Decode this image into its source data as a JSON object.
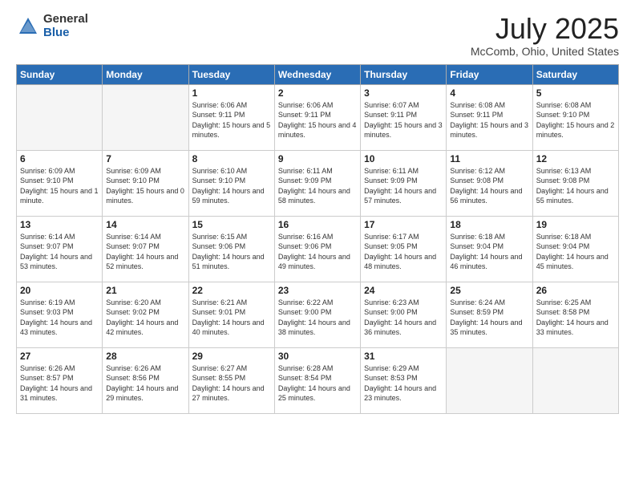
{
  "header": {
    "logo_general": "General",
    "logo_blue": "Blue",
    "title": "July 2025",
    "location": "McComb, Ohio, United States"
  },
  "days_of_week": [
    "Sunday",
    "Monday",
    "Tuesday",
    "Wednesday",
    "Thursday",
    "Friday",
    "Saturday"
  ],
  "weeks": [
    [
      {
        "num": "",
        "empty": true
      },
      {
        "num": "",
        "empty": true
      },
      {
        "num": "1",
        "sunrise": "Sunrise: 6:06 AM",
        "sunset": "Sunset: 9:11 PM",
        "daylight": "Daylight: 15 hours and 5 minutes."
      },
      {
        "num": "2",
        "sunrise": "Sunrise: 6:06 AM",
        "sunset": "Sunset: 9:11 PM",
        "daylight": "Daylight: 15 hours and 4 minutes."
      },
      {
        "num": "3",
        "sunrise": "Sunrise: 6:07 AM",
        "sunset": "Sunset: 9:11 PM",
        "daylight": "Daylight: 15 hours and 3 minutes."
      },
      {
        "num": "4",
        "sunrise": "Sunrise: 6:08 AM",
        "sunset": "Sunset: 9:11 PM",
        "daylight": "Daylight: 15 hours and 3 minutes."
      },
      {
        "num": "5",
        "sunrise": "Sunrise: 6:08 AM",
        "sunset": "Sunset: 9:10 PM",
        "daylight": "Daylight: 15 hours and 2 minutes."
      }
    ],
    [
      {
        "num": "6",
        "sunrise": "Sunrise: 6:09 AM",
        "sunset": "Sunset: 9:10 PM",
        "daylight": "Daylight: 15 hours and 1 minute."
      },
      {
        "num": "7",
        "sunrise": "Sunrise: 6:09 AM",
        "sunset": "Sunset: 9:10 PM",
        "daylight": "Daylight: 15 hours and 0 minutes."
      },
      {
        "num": "8",
        "sunrise": "Sunrise: 6:10 AM",
        "sunset": "Sunset: 9:10 PM",
        "daylight": "Daylight: 14 hours and 59 minutes."
      },
      {
        "num": "9",
        "sunrise": "Sunrise: 6:11 AM",
        "sunset": "Sunset: 9:09 PM",
        "daylight": "Daylight: 14 hours and 58 minutes."
      },
      {
        "num": "10",
        "sunrise": "Sunrise: 6:11 AM",
        "sunset": "Sunset: 9:09 PM",
        "daylight": "Daylight: 14 hours and 57 minutes."
      },
      {
        "num": "11",
        "sunrise": "Sunrise: 6:12 AM",
        "sunset": "Sunset: 9:08 PM",
        "daylight": "Daylight: 14 hours and 56 minutes."
      },
      {
        "num": "12",
        "sunrise": "Sunrise: 6:13 AM",
        "sunset": "Sunset: 9:08 PM",
        "daylight": "Daylight: 14 hours and 55 minutes."
      }
    ],
    [
      {
        "num": "13",
        "sunrise": "Sunrise: 6:14 AM",
        "sunset": "Sunset: 9:07 PM",
        "daylight": "Daylight: 14 hours and 53 minutes."
      },
      {
        "num": "14",
        "sunrise": "Sunrise: 6:14 AM",
        "sunset": "Sunset: 9:07 PM",
        "daylight": "Daylight: 14 hours and 52 minutes."
      },
      {
        "num": "15",
        "sunrise": "Sunrise: 6:15 AM",
        "sunset": "Sunset: 9:06 PM",
        "daylight": "Daylight: 14 hours and 51 minutes."
      },
      {
        "num": "16",
        "sunrise": "Sunrise: 6:16 AM",
        "sunset": "Sunset: 9:06 PM",
        "daylight": "Daylight: 14 hours and 49 minutes."
      },
      {
        "num": "17",
        "sunrise": "Sunrise: 6:17 AM",
        "sunset": "Sunset: 9:05 PM",
        "daylight": "Daylight: 14 hours and 48 minutes."
      },
      {
        "num": "18",
        "sunrise": "Sunrise: 6:18 AM",
        "sunset": "Sunset: 9:04 PM",
        "daylight": "Daylight: 14 hours and 46 minutes."
      },
      {
        "num": "19",
        "sunrise": "Sunrise: 6:18 AM",
        "sunset": "Sunset: 9:04 PM",
        "daylight": "Daylight: 14 hours and 45 minutes."
      }
    ],
    [
      {
        "num": "20",
        "sunrise": "Sunrise: 6:19 AM",
        "sunset": "Sunset: 9:03 PM",
        "daylight": "Daylight: 14 hours and 43 minutes."
      },
      {
        "num": "21",
        "sunrise": "Sunrise: 6:20 AM",
        "sunset": "Sunset: 9:02 PM",
        "daylight": "Daylight: 14 hours and 42 minutes."
      },
      {
        "num": "22",
        "sunrise": "Sunrise: 6:21 AM",
        "sunset": "Sunset: 9:01 PM",
        "daylight": "Daylight: 14 hours and 40 minutes."
      },
      {
        "num": "23",
        "sunrise": "Sunrise: 6:22 AM",
        "sunset": "Sunset: 9:00 PM",
        "daylight": "Daylight: 14 hours and 38 minutes."
      },
      {
        "num": "24",
        "sunrise": "Sunrise: 6:23 AM",
        "sunset": "Sunset: 9:00 PM",
        "daylight": "Daylight: 14 hours and 36 minutes."
      },
      {
        "num": "25",
        "sunrise": "Sunrise: 6:24 AM",
        "sunset": "Sunset: 8:59 PM",
        "daylight": "Daylight: 14 hours and 35 minutes."
      },
      {
        "num": "26",
        "sunrise": "Sunrise: 6:25 AM",
        "sunset": "Sunset: 8:58 PM",
        "daylight": "Daylight: 14 hours and 33 minutes."
      }
    ],
    [
      {
        "num": "27",
        "sunrise": "Sunrise: 6:26 AM",
        "sunset": "Sunset: 8:57 PM",
        "daylight": "Daylight: 14 hours and 31 minutes."
      },
      {
        "num": "28",
        "sunrise": "Sunrise: 6:26 AM",
        "sunset": "Sunset: 8:56 PM",
        "daylight": "Daylight: 14 hours and 29 minutes."
      },
      {
        "num": "29",
        "sunrise": "Sunrise: 6:27 AM",
        "sunset": "Sunset: 8:55 PM",
        "daylight": "Daylight: 14 hours and 27 minutes."
      },
      {
        "num": "30",
        "sunrise": "Sunrise: 6:28 AM",
        "sunset": "Sunset: 8:54 PM",
        "daylight": "Daylight: 14 hours and 25 minutes."
      },
      {
        "num": "31",
        "sunrise": "Sunrise: 6:29 AM",
        "sunset": "Sunset: 8:53 PM",
        "daylight": "Daylight: 14 hours and 23 minutes."
      },
      {
        "num": "",
        "empty": true
      },
      {
        "num": "",
        "empty": true
      }
    ]
  ]
}
